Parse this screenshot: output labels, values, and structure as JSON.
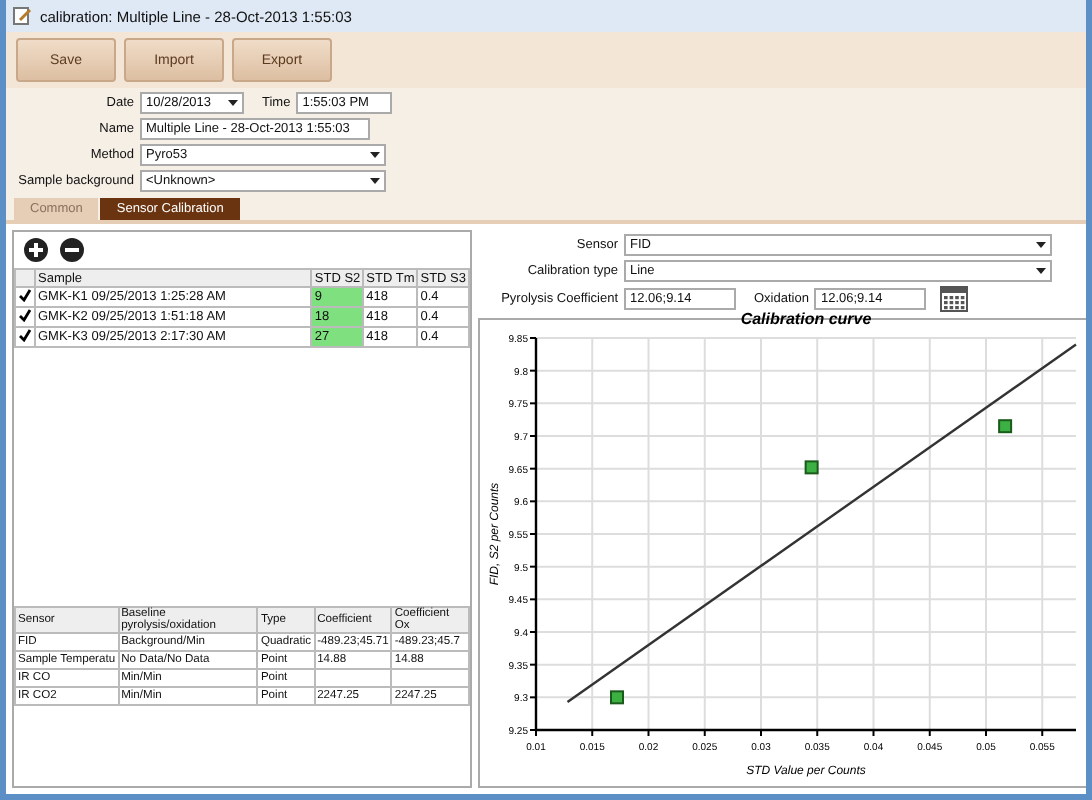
{
  "window": {
    "title": "calibration: Multiple Line - 28-Oct-2013 1:55:03"
  },
  "toolbar": [
    "Save",
    "Import",
    "Export"
  ],
  "form": {
    "date_label": "Date",
    "date": "10/28/2013",
    "time_label": "Time",
    "time": "1:55:03 PM",
    "name_label": "Name",
    "name": "Multiple Line - 28-Oct-2013 1:55:03",
    "method_label": "Method",
    "method": "Pyro53",
    "background_label": "Sample background",
    "background": "<Unknown>"
  },
  "tabs": [
    {
      "label": "Common",
      "selected": false
    },
    {
      "label": "Sensor Calibration",
      "selected": true
    }
  ],
  "samples": {
    "columns": [
      "Sample",
      "STD S2",
      "STD Tm",
      "STD S3"
    ],
    "rows": [
      {
        "checked": true,
        "sample": "GMK-K1 09/25/2013 1:25:28 AM",
        "s2": "9",
        "s2_highlighted": true,
        "tmax": "418",
        "s3": "0.4"
      },
      {
        "checked": true,
        "sample": "GMK-K2 09/25/2013 1:51:18 AM",
        "s2": "18",
        "s2_highlighted": true,
        "tmax": "418",
        "s3": "0.4"
      },
      {
        "checked": true,
        "sample": "GMK-K3 09/25/2013 2:17:30 AM",
        "s2": "27",
        "s2_highlighted": true,
        "tmax": "418",
        "s3": "0.4"
      }
    ]
  },
  "sensors": {
    "columns": [
      "Sensor",
      "Baseline pyrolysis/oxidation",
      "Type",
      "Coefficient",
      "Coefficient Ox"
    ],
    "rows": [
      [
        "FID",
        "Background/Min",
        "Quadratic",
        "-489.23;45.71",
        "-489.23;45.7"
      ],
      [
        "Sample Temperatu",
        "No Data/No Data",
        "Point",
        "14.88",
        "14.88"
      ],
      [
        "IR CO",
        "Min/Min",
        "Point",
        "",
        ""
      ],
      [
        "IR CO2",
        "Min/Min",
        "Point",
        "2247.25",
        "2247.25"
      ]
    ]
  },
  "calibration": {
    "sensor_label": "Sensor",
    "sensor": "FID",
    "type_label": "Calibration type",
    "type": "Line",
    "pyrolysis_label": "Pyrolysis Coefficient",
    "pyrolysis": "12.06;9.14",
    "oxidation_label": "Oxidation",
    "oxidation": "12.06;9.14",
    "chart_data": {
      "type": "scatter",
      "title": "Calibration curve",
      "xlabel": "STD Value per Counts",
      "ylabel": "FID, S2 per Counts",
      "xlim": [
        0.01,
        0.058
      ],
      "grid": true,
      "ylim": [
        9.25,
        9.85
      ],
      "xticks": [
        0.01,
        0.015,
        0.02,
        0.025,
        0.03,
        0.035,
        0.04,
        0.045,
        0.05,
        0.055
      ],
      "yticks": [
        9.25,
        9.3,
        9.35,
        9.4,
        9.45,
        9.5,
        9.55,
        9.6,
        9.65,
        9.7,
        9.75,
        9.8,
        9.85
      ],
      "series": [
        {
          "color": "#3cb043",
          "x": [
            0.0172,
            0.0345,
            0.0517
          ],
          "values": [
            9.3,
            9.652,
            9.715
          ]
        },
        {
          "type": "line",
          "color": "#333333",
          "x": [
            0.0128,
            0.058
          ],
          "values": [
            9.293,
            9.84
          ]
        }
      ]
    }
  }
}
